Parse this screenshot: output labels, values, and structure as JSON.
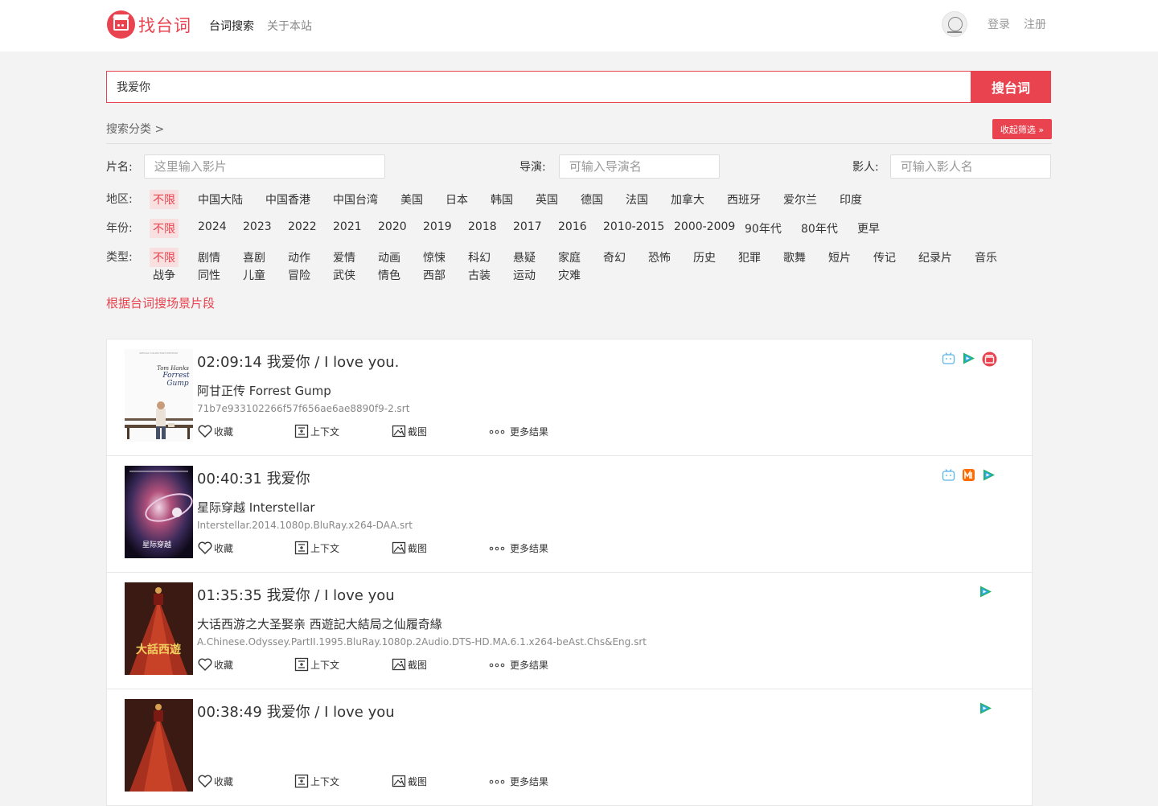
{
  "header": {
    "logo_text": "找台词",
    "nav": [
      {
        "label": "台词搜索",
        "active": true
      },
      {
        "label": "关于本站",
        "active": false
      }
    ],
    "login": "登录",
    "register": "注册"
  },
  "search": {
    "value": "我爱你",
    "button": "搜台词"
  },
  "filters": {
    "category_title": "搜索分类 >",
    "collapse_label": "收起筛选 »",
    "name_label": "片名:",
    "name_placeholder": "这里输入影片",
    "director_label": "导演:",
    "director_placeholder": "可输入导演名",
    "actor_label": "影人:",
    "actor_placeholder": "可输入影人名",
    "region_label": "地区:",
    "regions": [
      "不限",
      "中国大陆",
      "中国香港",
      "中国台湾",
      "美国",
      "日本",
      "韩国",
      "英国",
      "德国",
      "法国",
      "加拿大",
      "西班牙",
      "爱尔兰",
      "印度"
    ],
    "year_label": "年份:",
    "years": [
      "不限",
      "2024",
      "2023",
      "2022",
      "2021",
      "2020",
      "2019",
      "2018",
      "2017",
      "2016",
      "2010-2015",
      "2000-2009",
      "90年代",
      "80年代",
      "更早"
    ],
    "genre_label": "类型:",
    "genres_row1": [
      "不限",
      "剧情",
      "喜剧",
      "动作",
      "爱情",
      "动画",
      "惊悚",
      "科幻",
      "悬疑",
      "家庭",
      "奇幻",
      "恐怖",
      "历史",
      "犯罪",
      "歌舞",
      "短片",
      "传记",
      "纪录片",
      "音乐"
    ],
    "genres_row2": [
      "战争",
      "同性",
      "儿童",
      "冒险",
      "武侠",
      "情色",
      "西部",
      "古装",
      "运动",
      "灾难"
    ]
  },
  "scene_link": "根据台词搜场景片段",
  "actions": {
    "favorite": "收藏",
    "context": "上下文",
    "screenshot": "截图",
    "more": "更多结果"
  },
  "results": [
    {
      "title": "02:09:14 我爱你 / I love you.",
      "movie": "阿甘正传 Forrest Gump",
      "file": "71b7e933102266f57f656ae6ae8890f9-2.srt",
      "poster_text": "Tom Hanks Forrest Gump",
      "sources": [
        "bilibili-icon",
        "tencent-video-icon",
        "mtime-icon"
      ]
    },
    {
      "title": "00:40:31 我爱你",
      "movie": "星际穿越 Interstellar",
      "file": "Interstellar.2014.1080p.BluRay.x264-DAA.srt",
      "poster_text": "星际穿越",
      "sources": [
        "bilibili-icon",
        "mgtv-icon",
        "tencent-video-icon"
      ]
    },
    {
      "title": "01:35:35 我爱你 / I love you",
      "movie": "大话西游之大圣娶亲 西遊記大結局之仙履奇緣",
      "file": "A.Chinese.Odyssey.PartII.1995.BluRay.1080p.2Audio.DTS-HD.MA.6.1.x264-beAst.Chs&Eng.srt",
      "poster_text": "大話西遊",
      "sources": [
        "tencent-video-icon"
      ]
    },
    {
      "title": "00:38:49 我爱你 / I love you",
      "movie": "",
      "file": "",
      "poster_text": "",
      "sources": [
        "tencent-video-icon"
      ]
    }
  ]
}
